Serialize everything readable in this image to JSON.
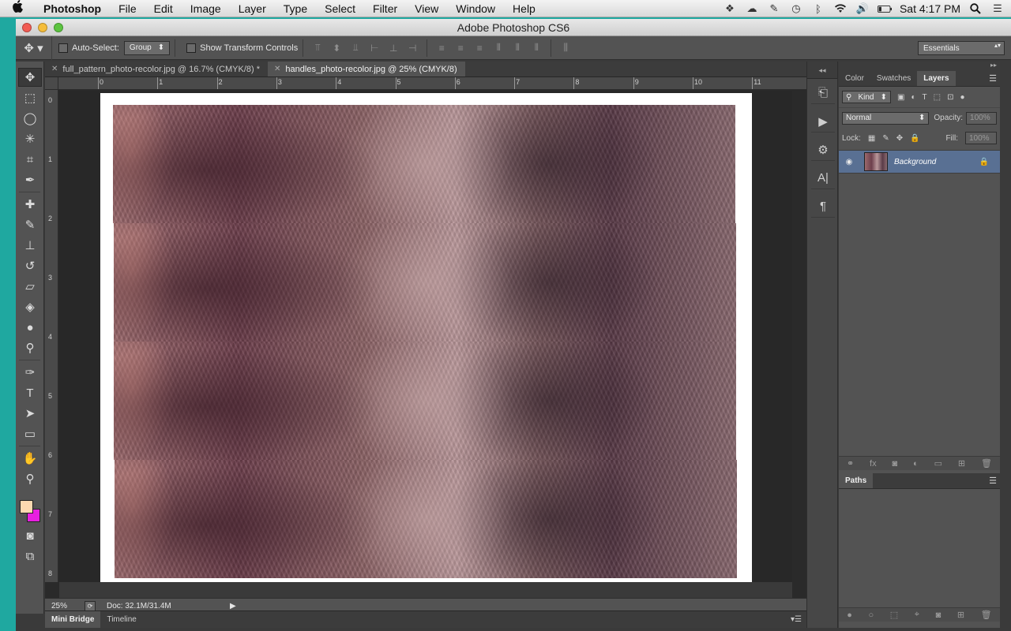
{
  "menubar": {
    "apple": "",
    "app": "Photoshop",
    "items": [
      "File",
      "Edit",
      "Image",
      "Layer",
      "Type",
      "Select",
      "Filter",
      "View",
      "Window",
      "Help"
    ],
    "clock": "Sat 4:17 PM"
  },
  "window": {
    "title": "Adobe Photoshop CS6"
  },
  "options": {
    "auto_select_label": "Auto-Select:",
    "auto_select_value": "Group",
    "show_transform_label": "Show Transform Controls",
    "workspace": "Essentials"
  },
  "tabs": [
    {
      "label": "full_pattern_photo-recolor.jpg @ 16.7% (CMYK/8) *",
      "close": "✕"
    },
    {
      "label": "handles_photo-recolor.jpg @ 25% (CMYK/8)",
      "close": "✕"
    }
  ],
  "rulers": {
    "h": [
      "0",
      "1",
      "2",
      "3",
      "4",
      "5",
      "6",
      "7",
      "8",
      "9",
      "10",
      "11"
    ],
    "v": [
      "0",
      "1",
      "2",
      "3",
      "4",
      "5",
      "6",
      "7",
      "8"
    ]
  },
  "status": {
    "zoom": "25%",
    "doc": "Doc: 32.1M/31.4M",
    "arrow": "▶"
  },
  "bottom_tabs": [
    "Mini Bridge",
    "Timeline"
  ],
  "layers_panel": {
    "tabs": [
      "Color",
      "Swatches",
      "Layers"
    ],
    "kind_label": "Kind",
    "blend_mode": "Normal",
    "opacity_label": "Opacity:",
    "opacity_value": "100%",
    "lock_label": "Lock:",
    "fill_label": "Fill:",
    "fill_value": "100%",
    "layer_name": "Background"
  },
  "paths_panel": {
    "tab": "Paths"
  },
  "colors": {
    "foreground": "#fcd8b0",
    "background": "#e81fe0",
    "active_layer": "#597093"
  }
}
